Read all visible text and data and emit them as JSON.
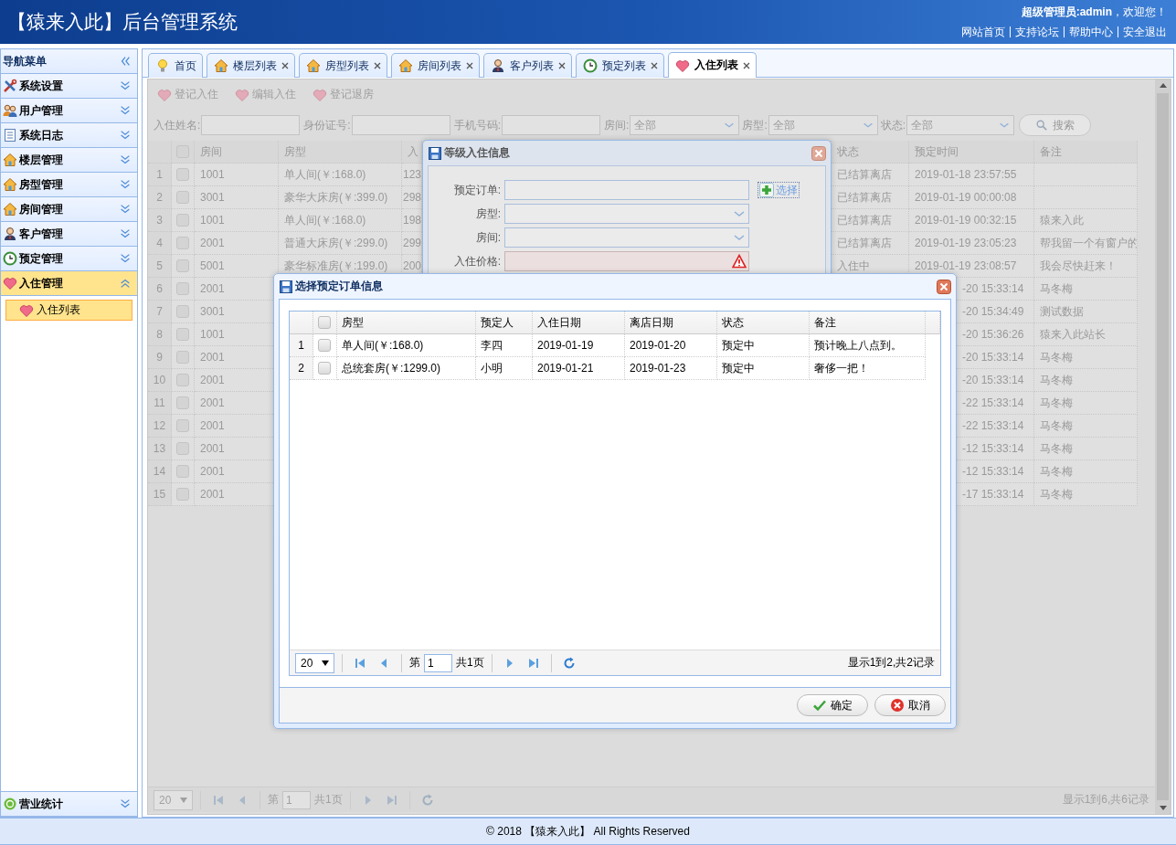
{
  "header": {
    "title": "【猿来入此】后台管理系统",
    "welcome": "**超级管理员:admin**，欢迎您！",
    "links": [
      "网站首页",
      "支持论坛",
      "帮助中心",
      "安全退出"
    ]
  },
  "sidebar": {
    "title": "导航菜单",
    "items": [
      {
        "label": "系统设置",
        "expanded": false
      },
      {
        "label": "用户管理",
        "expanded": false
      },
      {
        "label": "系统日志",
        "expanded": false
      },
      {
        "label": "楼层管理",
        "expanded": false
      },
      {
        "label": "房型管理",
        "expanded": false
      },
      {
        "label": "房间管理",
        "expanded": false
      },
      {
        "label": "客户管理",
        "expanded": false
      },
      {
        "label": "预定管理",
        "expanded": false
      },
      {
        "label": "入住管理",
        "expanded": true,
        "children": [
          {
            "label": "入住列表",
            "selected": true
          }
        ]
      },
      {
        "label": "营业统计",
        "expanded": false
      }
    ]
  },
  "tabs": [
    {
      "label": "首页",
      "selected": false,
      "closable": false
    },
    {
      "label": "楼层列表",
      "selected": false,
      "closable": true
    },
    {
      "label": "房型列表",
      "selected": false,
      "closable": true
    },
    {
      "label": "房间列表",
      "selected": false,
      "closable": true
    },
    {
      "label": "客户列表",
      "selected": false,
      "closable": true
    },
    {
      "label": "预定列表",
      "selected": false,
      "closable": true
    },
    {
      "label": "入住列表",
      "selected": true,
      "closable": true
    }
  ],
  "toolbar": [
    "登记入住",
    "编辑入住",
    "登记退房"
  ],
  "search": {
    "fields": [
      {
        "kind": "input",
        "label": "入住姓名:"
      },
      {
        "kind": "input",
        "label": "身份证号:"
      },
      {
        "kind": "input",
        "label": "手机号码:"
      },
      {
        "kind": "select",
        "label": "房间:",
        "value": "全部"
      },
      {
        "kind": "select",
        "label": "房型:",
        "value": "全部"
      },
      {
        "kind": "select",
        "label": "状态:",
        "value": "全部"
      }
    ],
    "button": "搜索"
  },
  "table": {
    "columns": [
      "房间",
      "房型",
      "入",
      "状态",
      "预定时间",
      "备注"
    ],
    "rows": [
      {
        "num": "1",
        "checked": false,
        "room": "1001",
        "room_type": "单人间(￥:168.0)",
        "column_5": "123",
        "status": "已结算离店",
        "time": "2019-01-18 23:57:55"
      },
      {
        "num": "2",
        "checked": false,
        "room": "3001",
        "room_type": "豪华大床房(￥:399.0)",
        "column_5": "298",
        "status": "已结算离店",
        "time": "2019-01-19 00:00:08"
      },
      {
        "num": "3",
        "checked": false,
        "room": "1001",
        "room_type": "单人间(￥:168.0)",
        "column_5": "198",
        "status": "已结算离店",
        "time": "2019-01-19 00:32:15",
        "note": "猿来入此"
      },
      {
        "num": "4",
        "checked": false,
        "room": "2001",
        "room_type": "普通大床房(￥:299.0)",
        "column_5": "299",
        "status": "已结算离店",
        "time": "2019-01-19 23:05:23",
        "note": "帮我留一个有窗户的"
      },
      {
        "num": "5",
        "checked": false,
        "room": "5001",
        "room_type": "豪华标准房(￥:199.0)",
        "column_5": "200",
        "status": "入住中",
        "time": "2019-01-19 23:08:57",
        "note": "我会尽快赶来！"
      },
      {
        "num": "6",
        "checked": false,
        "room": "2001",
        "time": "-20 15:33:14",
        "note": "马冬梅"
      },
      {
        "num": "7",
        "checked": false,
        "room": "3001",
        "time": "-20 15:34:49",
        "note": "测试数据"
      },
      {
        "num": "8",
        "checked": false,
        "room": "1001",
        "time": "-20 15:36:26",
        "note": "猿来入此站长"
      },
      {
        "num": "9",
        "checked": false,
        "room": "2001",
        "time": "-20 15:33:14",
        "note": "马冬梅"
      },
      {
        "num": "10",
        "checked": false,
        "room": "2001",
        "time": "-20 15:33:14",
        "note": "马冬梅"
      },
      {
        "num": "11",
        "checked": false,
        "room": "2001",
        "time": "-22 15:33:14",
        "note": "马冬梅"
      },
      {
        "num": "12",
        "checked": false,
        "room": "2001",
        "time": "-22 15:33:14",
        "note": "马冬梅"
      },
      {
        "num": "13",
        "checked": false,
        "room": "2001",
        "time": "-12 15:33:14",
        "note": "马冬梅"
      },
      {
        "num": "14",
        "checked": false,
        "room": "2001",
        "time": "-12 15:33:14",
        "note": "马冬梅"
      },
      {
        "num": "15",
        "checked": false,
        "room": "2001",
        "time": "-17 15:33:14",
        "note": "马冬梅"
      }
    ],
    "header_checked": false
  },
  "pager": {
    "page_size": "20",
    "page_label": "第",
    "page": "1",
    "total_pages": "共1页",
    "summary": "显示1到6,共6记录"
  },
  "checkin_dialog": {
    "title": "等级入住信息",
    "fields": [
      {
        "kind": "input",
        "label": "预定订单:",
        "button": "选择"
      },
      {
        "kind": "combo",
        "label": "房型:"
      },
      {
        "kind": "combo",
        "label": "房间:"
      },
      {
        "kind": "input",
        "label": "入住价格:",
        "invalid": true
      }
    ]
  },
  "order_dialog": {
    "title": "选择预定订单信息",
    "header_checked": false,
    "columns": [
      "房型",
      "预定人",
      "入住日期",
      "离店日期",
      "状态",
      "备注"
    ],
    "rows": [
      {
        "num": "1",
        "checked": false,
        "cells": [
          "单人间(￥:168.0)",
          "李四",
          "2019-01-19",
          "2019-01-20",
          "预定中",
          "预计晚上八点到。"
        ]
      },
      {
        "num": "2",
        "checked": false,
        "cells": [
          "总统套房(￥:1299.0)",
          "小明",
          "2019-01-21",
          "2019-01-23",
          "预定中",
          "奢侈一把！"
        ]
      }
    ],
    "pager": {
      "page_size": "20",
      "page_label": "第",
      "page": "1",
      "total_pages": "共1页",
      "summary": "显示1到2,共2记录"
    },
    "buttons": [
      {
        "kind": "ok",
        "label": "确定"
      },
      {
        "kind": "cancel",
        "label": "取消"
      }
    ]
  },
  "footer": "© 2018 【猿来入此】 All Rights Reserved"
}
